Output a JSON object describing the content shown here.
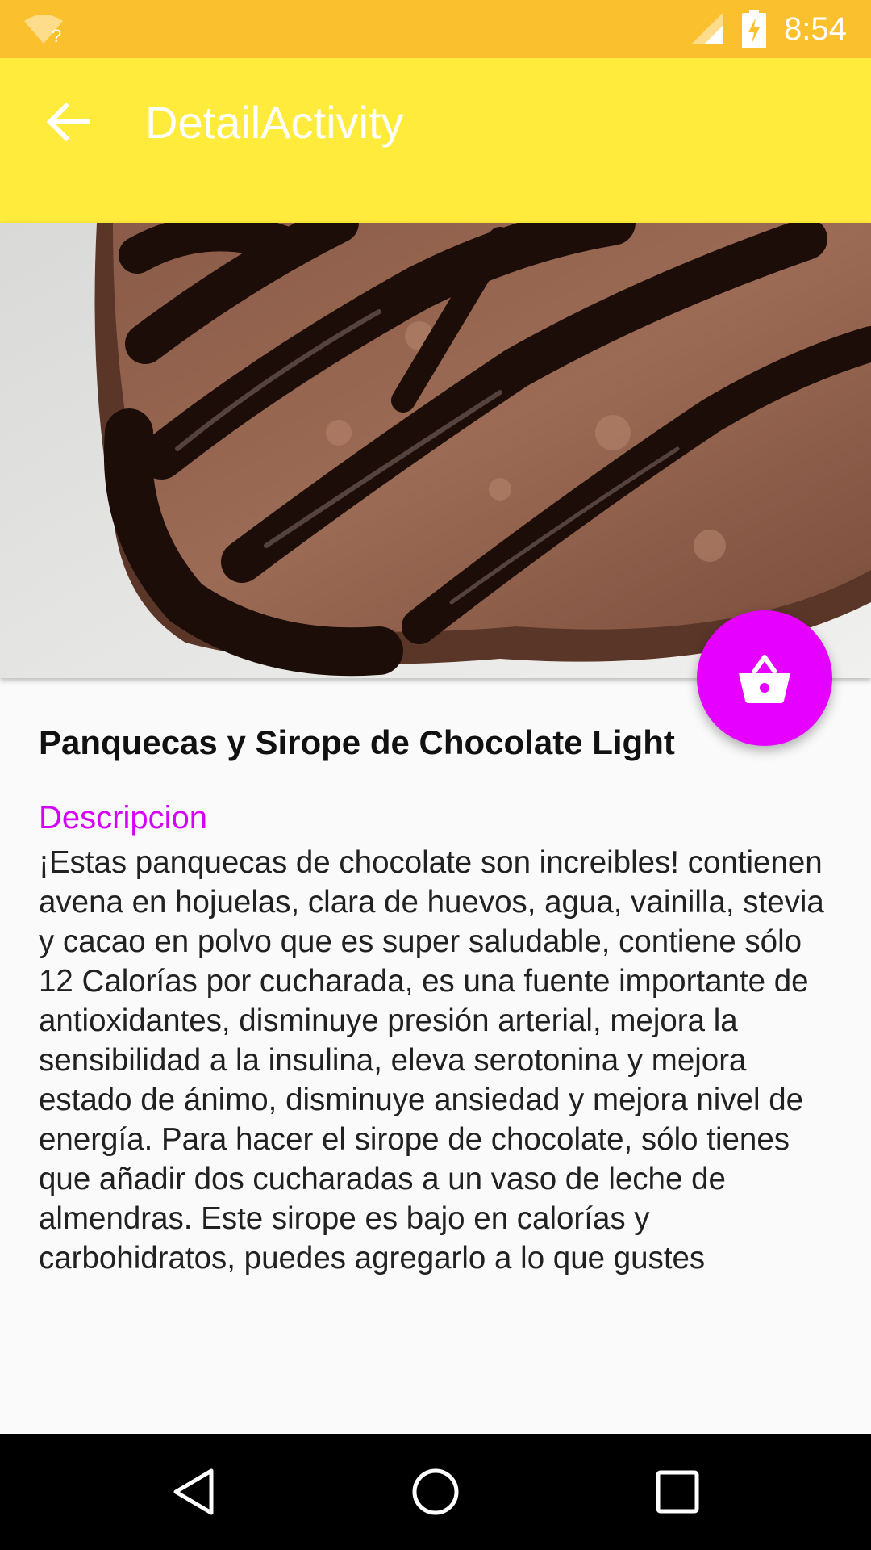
{
  "status_bar": {
    "time": "8:54",
    "wifi_icon": "wifi-unknown-icon",
    "signal_icon": "cell-signal-icon",
    "battery_icon": "battery-charging-icon",
    "background": "#fbc02d"
  },
  "app_bar": {
    "title": "DetailActivity",
    "back_icon": "arrow-back-icon",
    "background": "#ffeb3b"
  },
  "hero": {
    "icon": "photo-chocolate-pancakes"
  },
  "fab": {
    "icon": "shopping-basket-icon",
    "color": "#e500ff"
  },
  "detail": {
    "title": "Panquecas y Sirope de Chocolate Light",
    "section_label": "Descripcion",
    "description": "¡Estas panquecas de chocolate son increibles! contienen avena en hojuelas, clara de huevos, agua, vainilla, stevia y cacao en polvo que es super saludable, contiene sólo 12 Calorías por cucharada, es una fuente importante de antioxidantes, disminuye presión arterial, mejora la sensibilidad a la insulina, eleva serotonina y mejora estado de ánimo, disminuye ansiedad y mejora nivel de energía. Para hacer el sirope de chocolate, sólo tienes que añadir dos cucharadas a un vaso de leche de almendras. Este sirope es bajo en calorías y carbohidratos, puedes agregarlo a lo que gustes",
    "accent_color": "#d500f9"
  },
  "nav_bar": {
    "back_icon": "nav-back-icon",
    "home_icon": "nav-home-icon",
    "recents_icon": "nav-recents-icon"
  }
}
